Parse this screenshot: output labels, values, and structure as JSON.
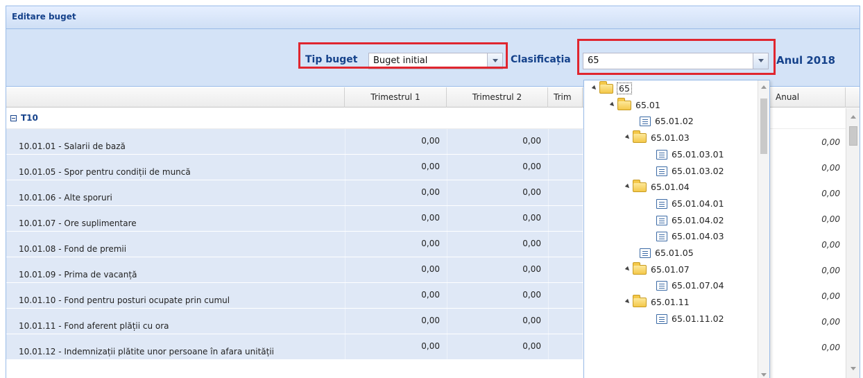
{
  "panel": {
    "title": "Editare buget"
  },
  "toolbar": {
    "tip_buget_label": "Tip buget",
    "tip_buget_value": "Buget initial",
    "clasificatia_label": "Clasificația",
    "clasificatia_value": "65",
    "anul_label": "Anul 2018"
  },
  "columns": [
    "Trimestrul 1",
    "Trimestrul 2",
    "Trim",
    "Anual"
  ],
  "group": {
    "label": "T10"
  },
  "rows": [
    {
      "name": "10.01.01 - Salarii de bază",
      "t1": "0,00",
      "t2": "0,00",
      "anual": "0,00"
    },
    {
      "name": "10.01.05 - Spor pentru condiții de muncă",
      "t1": "0,00",
      "t2": "0,00",
      "anual": "0,00"
    },
    {
      "name": "10.01.06 - Alte sporuri",
      "t1": "0,00",
      "t2": "0,00",
      "anual": "0,00"
    },
    {
      "name": "10.01.07 - Ore suplimentare",
      "t1": "0,00",
      "t2": "0,00",
      "anual": "0,00"
    },
    {
      "name": "10.01.08 - Fond de premii",
      "t1": "0,00",
      "t2": "0,00",
      "anual": "0,00"
    },
    {
      "name": "10.01.09 - Prima de vacanță",
      "t1": "0,00",
      "t2": "0,00",
      "anual": "0,00"
    },
    {
      "name": "10.01.10 - Fond pentru posturi ocupate prin cumul",
      "t1": "0,00",
      "t2": "0,00",
      "anual": "0,00"
    },
    {
      "name": "10.01.11 - Fond aferent plății cu ora",
      "t1": "0,00",
      "t2": "0,00",
      "anual": "0,00"
    },
    {
      "name": "10.01.12 - Indemnizații plătite unor persoane în afara unității",
      "t1": "0,00",
      "t2": "0,00",
      "anual": "0,00"
    }
  ],
  "tree": [
    {
      "label": "65",
      "kind": "folder",
      "level": 0
    },
    {
      "label": "65.01",
      "kind": "folder",
      "level": 1
    },
    {
      "label": "65.01.02",
      "kind": "leaf",
      "level": 2
    },
    {
      "label": "65.01.03",
      "kind": "folder",
      "level": 2
    },
    {
      "label": "65.01.03.01",
      "kind": "leaf",
      "level": 3
    },
    {
      "label": "65.01.03.02",
      "kind": "leaf",
      "level": 3
    },
    {
      "label": "65.01.04",
      "kind": "folder",
      "level": 2
    },
    {
      "label": "65.01.04.01",
      "kind": "leaf",
      "level": 3
    },
    {
      "label": "65.01.04.02",
      "kind": "leaf",
      "level": 3
    },
    {
      "label": "65.01.04.03",
      "kind": "leaf",
      "level": 3
    },
    {
      "label": "65.01.05",
      "kind": "leaf",
      "level": 2
    },
    {
      "label": "65.01.07",
      "kind": "folder",
      "level": 2
    },
    {
      "label": "65.01.07.04",
      "kind": "leaf",
      "level": 3
    },
    {
      "label": "65.01.11",
      "kind": "folder",
      "level": 2
    },
    {
      "label": "65.01.11.02",
      "kind": "leaf",
      "level": 3
    }
  ],
  "colors": {
    "highlight": "#e0262f",
    "header_text": "#15428b",
    "toolbar_bg": "#d4e3f7",
    "row_bg": "#dfe8f6"
  }
}
